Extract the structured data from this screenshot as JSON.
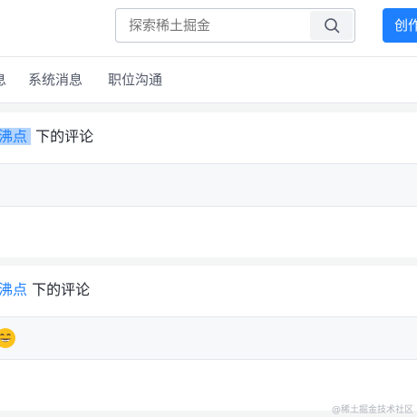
{
  "header": {
    "search_placeholder": "探索稀土掘金",
    "create_label": "创作者中心"
  },
  "tabs": [
    {
      "label": "息"
    },
    {
      "label": "系统消息"
    },
    {
      "label": "职位沟通"
    }
  ],
  "cards": [
    {
      "link_text": "沸点",
      "suffix": " 下的评论"
    },
    {
      "link_text": "沸点",
      "suffix": " 下的评论"
    }
  ],
  "watermark": "@稀土掘金技术社区",
  "colors": {
    "accent": "#1e80ff",
    "highlight": "#b3d4fc"
  }
}
